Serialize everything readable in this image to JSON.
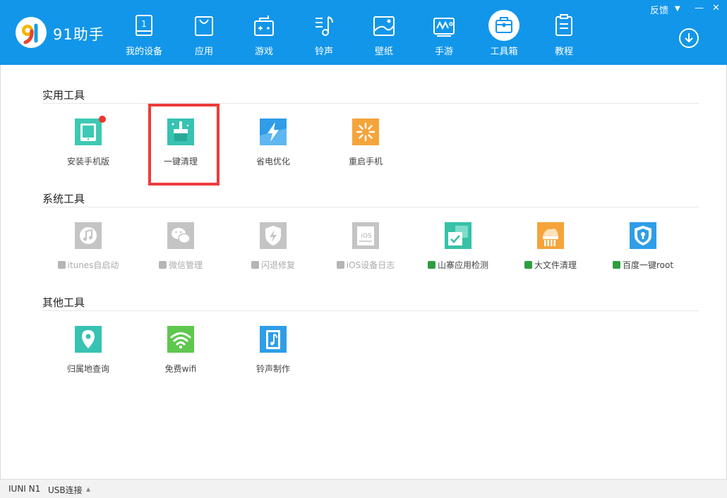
{
  "app": {
    "title": "91助手"
  },
  "window_controls": {
    "feedback": "反馈",
    "menu": "▼",
    "minimize": "—",
    "close": "✕"
  },
  "nav": [
    {
      "label": "我的设备",
      "icon": "device-icon"
    },
    {
      "label": "应用",
      "icon": "shopping-bag-icon"
    },
    {
      "label": "游戏",
      "icon": "gamepad-icon"
    },
    {
      "label": "铃声",
      "icon": "music-note-icon"
    },
    {
      "label": "壁纸",
      "icon": "wallpaper-icon"
    },
    {
      "label": "手游",
      "icon": "mobile-game-icon"
    },
    {
      "label": "工具箱",
      "icon": "toolbox-icon",
      "active": true
    },
    {
      "label": "教程",
      "icon": "clipboard-icon"
    }
  ],
  "colors": {
    "brand": "#1296ea",
    "highlight": "#ee3b3b",
    "android": "#2e9e3f",
    "badge": "#f0342f"
  },
  "sections": {
    "practical": {
      "title": "实用工具",
      "tools": [
        {
          "label": "安装手机版",
          "icon": "tablet-install-icon",
          "badge": true
        },
        {
          "label": "一键清理",
          "icon": "broom-clean-icon"
        },
        {
          "label": "省电优化",
          "icon": "lightning-icon"
        },
        {
          "label": "重启手机",
          "icon": "restart-spinner-icon"
        }
      ]
    },
    "system": {
      "title": "系统工具",
      "tools": [
        {
          "label": "itunes自启动",
          "icon": "itunes-icon",
          "platform": "apple"
        },
        {
          "label": "微信管理",
          "icon": "wechat-icon",
          "platform": "apple"
        },
        {
          "label": "闪退修复",
          "icon": "shield-flash-icon",
          "platform": "apple"
        },
        {
          "label": "iOS设备日志",
          "icon": "ios-log-icon",
          "platform": "apple"
        },
        {
          "label": "山寨应用检测",
          "icon": "app-check-icon",
          "platform": "android"
        },
        {
          "label": "大文件清理",
          "icon": "big-file-clean-icon",
          "platform": "android"
        },
        {
          "label": "百度一键root",
          "icon": "root-shield-icon",
          "platform": "android"
        }
      ]
    },
    "other": {
      "title": "其他工具",
      "tools": [
        {
          "label": "归属地查询",
          "icon": "location-pin-icon"
        },
        {
          "label": "免费wifi",
          "icon": "wifi-icon"
        },
        {
          "label": "铃声制作",
          "icon": "ringtone-make-icon"
        }
      ]
    }
  },
  "statusbar": {
    "device": "IUNI N1",
    "connection": "USB连接",
    "arrow": "▲"
  }
}
